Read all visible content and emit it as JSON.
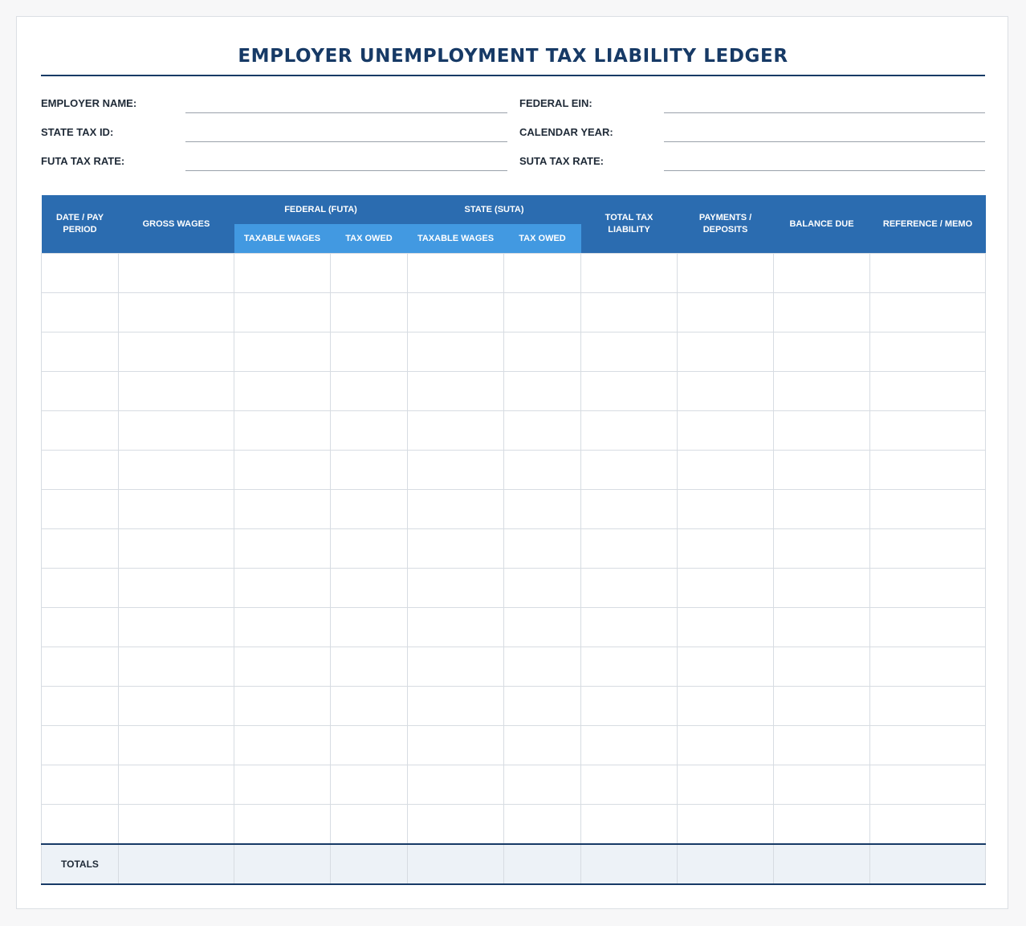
{
  "title": "EMPLOYER UNEMPLOYMENT TAX LIABILITY LEDGER",
  "fields": {
    "employer_name": {
      "label": "EMPLOYER NAME:",
      "value": ""
    },
    "federal_ein": {
      "label": "FEDERAL EIN:",
      "value": ""
    },
    "state_tax_id": {
      "label": "STATE TAX ID:",
      "value": ""
    },
    "calendar_year": {
      "label": "CALENDAR YEAR:",
      "value": ""
    },
    "futa_tax_rate": {
      "label": "FUTA TAX RATE:",
      "value": ""
    },
    "suta_tax_rate": {
      "label": "SUTA TAX RATE:",
      "value": ""
    }
  },
  "table": {
    "headers": {
      "date_pay_period": "DATE / PAY PERIOD",
      "gross_wages": "GROSS WAGES",
      "federal_group": "FEDERAL (FUTA)",
      "federal_taxable_wages": "TAXABLE WAGES",
      "federal_tax_owed": "TAX OWED",
      "state_group": "STATE (SUTA)",
      "state_taxable_wages": "TAXABLE WAGES",
      "state_tax_owed": "TAX OWED",
      "total_tax_liability": "TOTAL TAX LIABILITY",
      "payments_deposits": "PAYMENTS / DEPOSITS",
      "balance_due": "BALANCE DUE",
      "reference_memo": "REFERENCE / MEMO"
    },
    "row_count": 15,
    "totals_label": "TOTALS"
  }
}
